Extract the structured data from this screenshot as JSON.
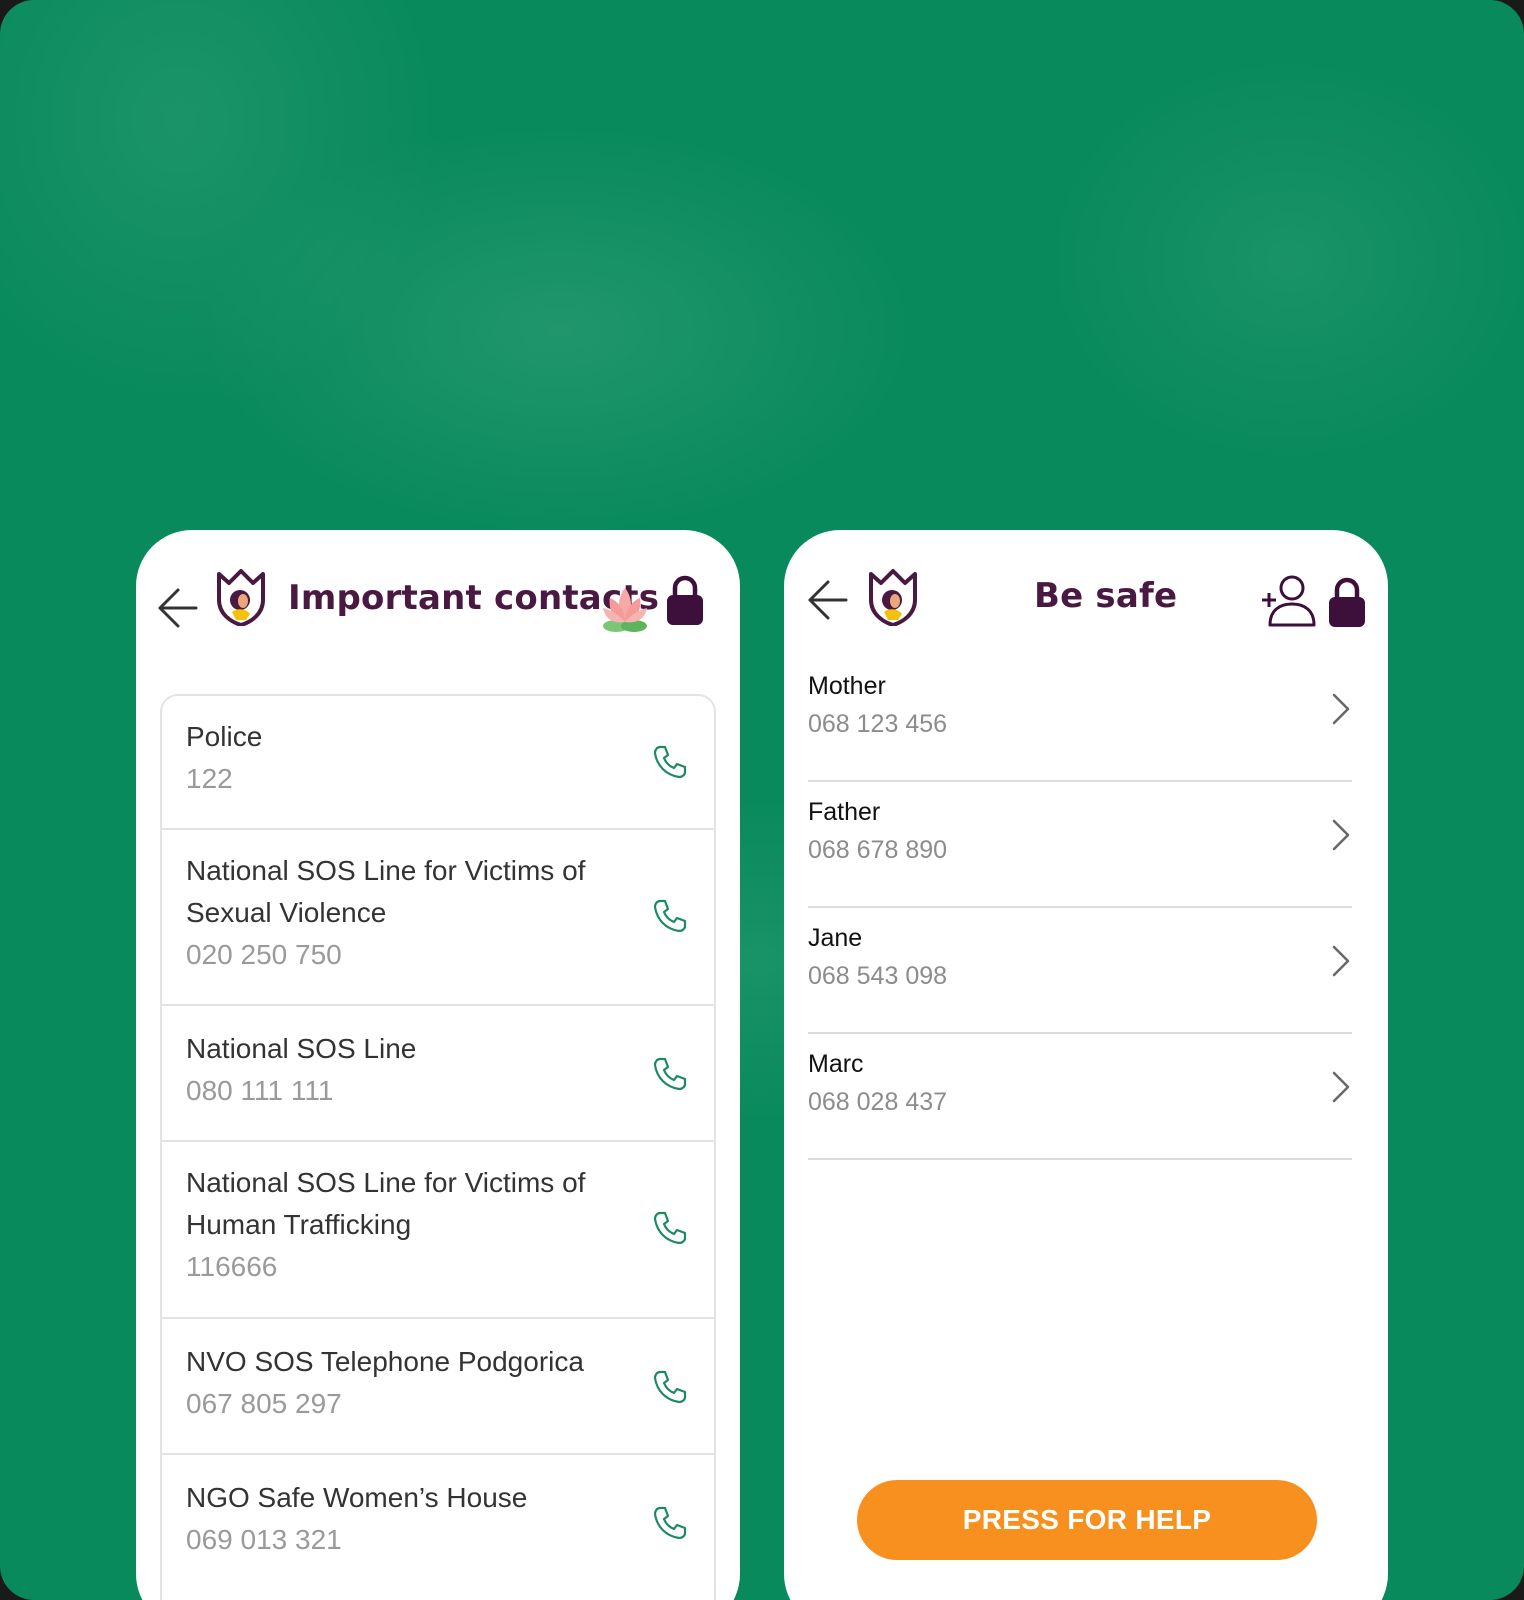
{
  "colors": {
    "background": "#088a5c",
    "brand_purple": "#4a1942",
    "call_green": "#1c8a5e",
    "help_orange": "#f7901e"
  },
  "left_screen": {
    "title": "Important contacts",
    "icons": [
      "back-arrow-icon",
      "app-logo-icon",
      "lotus-icon",
      "lock-icon"
    ],
    "contacts": [
      {
        "name": "Police",
        "number": "122"
      },
      {
        "name": "National SOS Line for Victims of Sexual Violence",
        "number": "020 250 750"
      },
      {
        "name": "National SOS Line",
        "number": "080 111 111"
      },
      {
        "name": "National SOS Line for Victims of Human Trafficking",
        "number": "116666"
      },
      {
        "name": "NVO SOS Telephone Podgorica",
        "number": "067 805 297"
      },
      {
        "name": "NGO Safe Women’s House",
        "number": "069 013 321"
      }
    ]
  },
  "right_screen": {
    "title": "Be safe",
    "icons": [
      "back-arrow-icon",
      "app-logo-icon",
      "add-person-icon",
      "lock-icon"
    ],
    "people": [
      {
        "name": "Mother",
        "number": "068 123 456"
      },
      {
        "name": "Father",
        "number": "068 678 890"
      },
      {
        "name": "Jane",
        "number": "068 543 098"
      },
      {
        "name": "Marc",
        "number": "068 028 437"
      }
    ],
    "help_button": "PRESS FOR HELP"
  }
}
